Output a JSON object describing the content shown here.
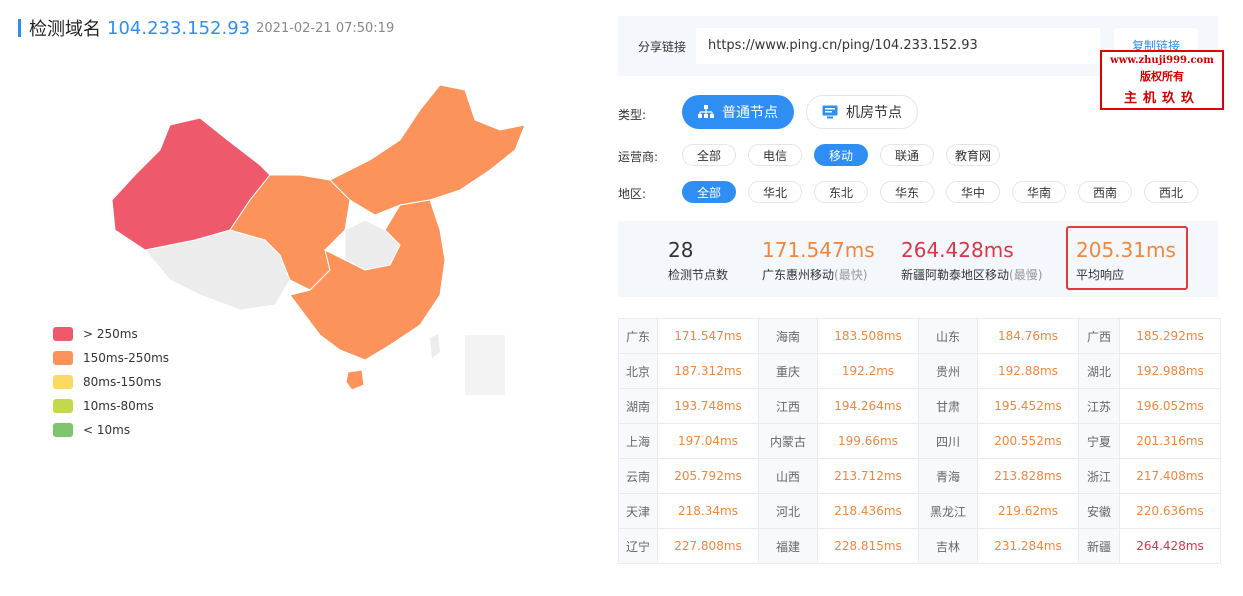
{
  "header": {
    "label": "检测域名",
    "domain": "104.233.152.93",
    "time": "2021-02-21 07:50:19"
  },
  "legend": [
    {
      "label": "> 250ms",
      "color": "#ee5a6c"
    },
    {
      "label": "150ms-250ms",
      "color": "#fc935a"
    },
    {
      "label": "80ms-150ms",
      "color": "#fcd864"
    },
    {
      "label": "10ms-80ms",
      "color": "#c3d84d"
    },
    {
      "label": "< 10ms",
      "color": "#7ec46a"
    }
  ],
  "share": {
    "label": "分享链接",
    "url": "https://www.ping.cn/ping/104.233.152.93",
    "copy_label": "复制链接"
  },
  "watermark": {
    "site": "www.zhuji999.com",
    "line2": "版权所有",
    "line3": "主机玖玖"
  },
  "filters": {
    "type_label": "类型:",
    "types": [
      "普通节点",
      "机房节点"
    ],
    "isp_label": "运营商:",
    "isps": [
      "全部",
      "电信",
      "移动",
      "联通",
      "教育网"
    ],
    "region_label": "地区:",
    "regions": [
      "全部",
      "华北",
      "东北",
      "华东",
      "华中",
      "华南",
      "西南",
      "西北"
    ]
  },
  "stats": {
    "count": "28",
    "count_label": "检测节点数",
    "fastest": "171.547ms",
    "fastest_label": "广东惠州移动",
    "fastest_tag": "(最快)",
    "slowest": "264.428ms",
    "slowest_label": "新疆阿勒泰地区移动",
    "slowest_tag": "(最慢)",
    "avg": "205.31ms",
    "avg_label": "平均响应"
  },
  "results": [
    [
      [
        "广东",
        "171.547ms"
      ],
      [
        "海南",
        "183.508ms"
      ],
      [
        "山东",
        "184.76ms"
      ],
      [
        "广西",
        "185.292ms"
      ]
    ],
    [
      [
        "北京",
        "187.312ms"
      ],
      [
        "重庆",
        "192.2ms"
      ],
      [
        "贵州",
        "192.88ms"
      ],
      [
        "湖北",
        "192.988ms"
      ]
    ],
    [
      [
        "湖南",
        "193.748ms"
      ],
      [
        "江西",
        "194.264ms"
      ],
      [
        "甘肃",
        "195.452ms"
      ],
      [
        "江苏",
        "196.052ms"
      ]
    ],
    [
      [
        "上海",
        "197.04ms"
      ],
      [
        "内蒙古",
        "199.66ms"
      ],
      [
        "四川",
        "200.552ms"
      ],
      [
        "宁夏",
        "201.316ms"
      ]
    ],
    [
      [
        "云南",
        "205.792ms"
      ],
      [
        "山西",
        "213.712ms"
      ],
      [
        "青海",
        "213.828ms"
      ],
      [
        "浙江",
        "217.408ms"
      ]
    ],
    [
      [
        "天津",
        "218.34ms"
      ],
      [
        "河北",
        "218.436ms"
      ],
      [
        "黑龙江",
        "219.62ms"
      ],
      [
        "安徽",
        "220.636ms"
      ]
    ],
    [
      [
        "辽宁",
        "227.808ms"
      ],
      [
        "福建",
        "228.815ms"
      ],
      [
        "吉林",
        "231.284ms"
      ],
      [
        "新疆",
        "264.428ms"
      ]
    ]
  ],
  "colors": {
    "accent": "#2f8ef4",
    "orange": "#f4863c",
    "red": "#d9364a"
  }
}
